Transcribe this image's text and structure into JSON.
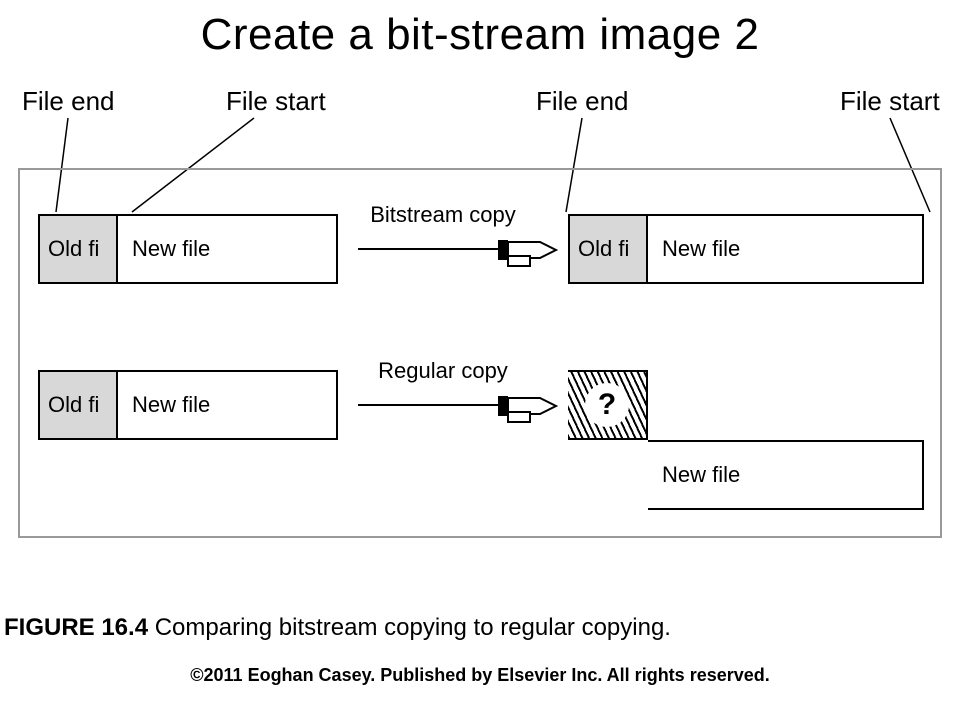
{
  "title": "Create a bit-stream image 2",
  "pointer_labels": {
    "file_end_1": "File end",
    "file_start_1": "File start",
    "file_end_2": "File end",
    "file_start_2": "File start"
  },
  "row1": {
    "left_old": "Old fi",
    "left_new": "New file",
    "mid_label": "Bitstream copy",
    "right_old": "Old fi",
    "right_new": "New file"
  },
  "row2": {
    "left_old": "Old fi",
    "left_new": "New file",
    "mid_label": "Regular copy",
    "right_q": "?",
    "right_new": "New file"
  },
  "caption_bold": "FIGURE 16.4",
  "caption_rest": " Comparing bitstream copying to regular copying.",
  "copyright": "©2011 Eoghan Casey. Published by Elsevier Inc. All rights reserved."
}
